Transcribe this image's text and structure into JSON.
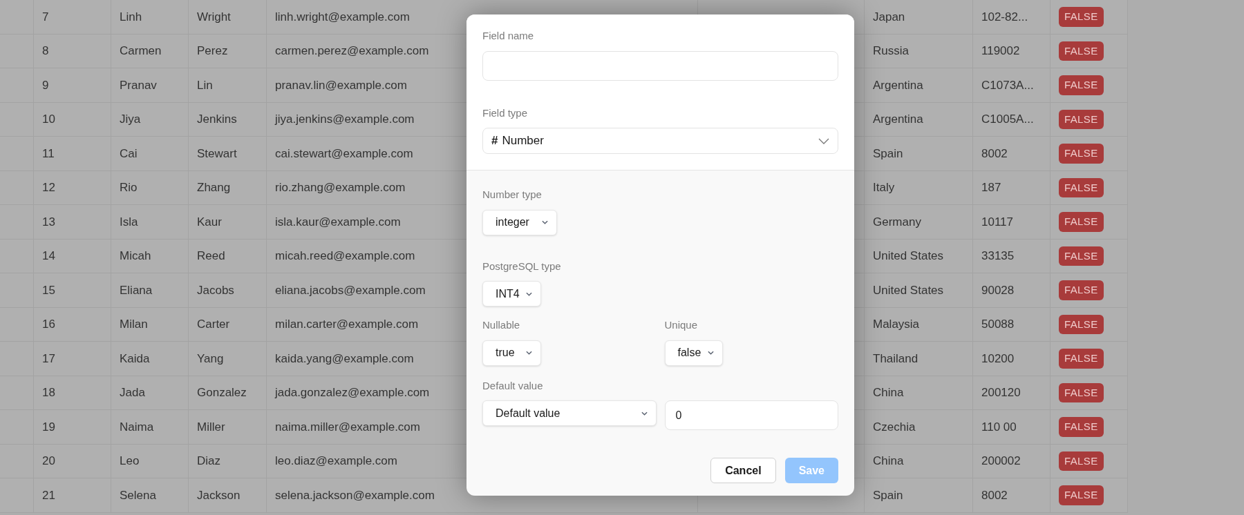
{
  "table": {
    "rows": [
      {
        "id": "7",
        "first_name": "Linh",
        "last_name": "Wright",
        "email": "linh.wright@example.com",
        "country": "Japan",
        "postal_code": "102-82...",
        "flag": "FALSE"
      },
      {
        "id": "8",
        "first_name": "Carmen",
        "last_name": "Perez",
        "email": "carmen.perez@example.com",
        "country": "Russia",
        "postal_code": "119002",
        "flag": "FALSE"
      },
      {
        "id": "9",
        "first_name": "Pranav",
        "last_name": "Lin",
        "email": "pranav.lin@example.com",
        "country": "Argentina",
        "postal_code": "C1073A...",
        "flag": "FALSE"
      },
      {
        "id": "10",
        "first_name": "Jiya",
        "last_name": "Jenkins",
        "email": "jiya.jenkins@example.com",
        "country": "Argentina",
        "postal_code": "C1005A...",
        "flag": "FALSE"
      },
      {
        "id": "11",
        "first_name": "Cai",
        "last_name": "Stewart",
        "email": "cai.stewart@example.com",
        "country": "Spain",
        "postal_code": "8002",
        "flag": "FALSE"
      },
      {
        "id": "12",
        "first_name": "Rio",
        "last_name": "Zhang",
        "email": "rio.zhang@example.com",
        "country": "Italy",
        "postal_code": "187",
        "flag": "FALSE"
      },
      {
        "id": "13",
        "first_name": "Isla",
        "last_name": "Kaur",
        "email": "isla.kaur@example.com",
        "country": "Germany",
        "postal_code": "10117",
        "flag": "FALSE"
      },
      {
        "id": "14",
        "first_name": "Micah",
        "last_name": "Reed",
        "email": "micah.reed@example.com",
        "country": "United States",
        "postal_code": "33135",
        "flag": "FALSE"
      },
      {
        "id": "15",
        "first_name": "Eliana",
        "last_name": "Jacobs",
        "email": "eliana.jacobs@example.com",
        "country": "United States",
        "postal_code": "90028",
        "flag": "FALSE"
      },
      {
        "id": "16",
        "first_name": "Milan",
        "last_name": "Carter",
        "email": "milan.carter@example.com",
        "country": "Malaysia",
        "postal_code": "50088",
        "flag": "FALSE"
      },
      {
        "id": "17",
        "first_name": "Kaida",
        "last_name": "Yang",
        "email": "kaida.yang@example.com",
        "country": "Thailand",
        "postal_code": "10200",
        "flag": "FALSE"
      },
      {
        "id": "18",
        "first_name": "Jada",
        "last_name": "Gonzalez",
        "email": "jada.gonzalez@example.com",
        "country": "China",
        "postal_code": "200120",
        "flag": "FALSE"
      },
      {
        "id": "19",
        "first_name": "Naima",
        "last_name": "Miller",
        "email": "naima.miller@example.com",
        "country": "Czechia",
        "postal_code": "110 00",
        "flag": "FALSE"
      },
      {
        "id": "20",
        "first_name": "Leo",
        "last_name": "Diaz",
        "email": "leo.diaz@example.com",
        "country": "China",
        "postal_code": "200002",
        "flag": "FALSE"
      },
      {
        "id": "21",
        "first_name": "Selena",
        "last_name": "Jackson",
        "email": "selena.jackson@example.com",
        "country": "Spain",
        "postal_code": "8002",
        "flag": "FALSE"
      }
    ]
  },
  "dialog": {
    "field_name": {
      "label": "Field name"
    },
    "field_type": {
      "label": "Field type",
      "icon": "#",
      "value": "Number"
    },
    "number_type": {
      "label": "Number type",
      "value": "integer"
    },
    "postgres_type": {
      "label": "PostgreSQL type",
      "value": "INT4"
    },
    "nullable": {
      "label": "Nullable",
      "value": "true"
    },
    "unique": {
      "label": "Unique",
      "value": "false"
    },
    "default_value": {
      "label": "Default value",
      "mode": "Default value",
      "value": "0"
    },
    "buttons": [
      {
        "label": "Cancel",
        "kind": "secondary",
        "disabled": false
      },
      {
        "label": "Save",
        "kind": "primary",
        "disabled": true
      }
    ]
  }
}
